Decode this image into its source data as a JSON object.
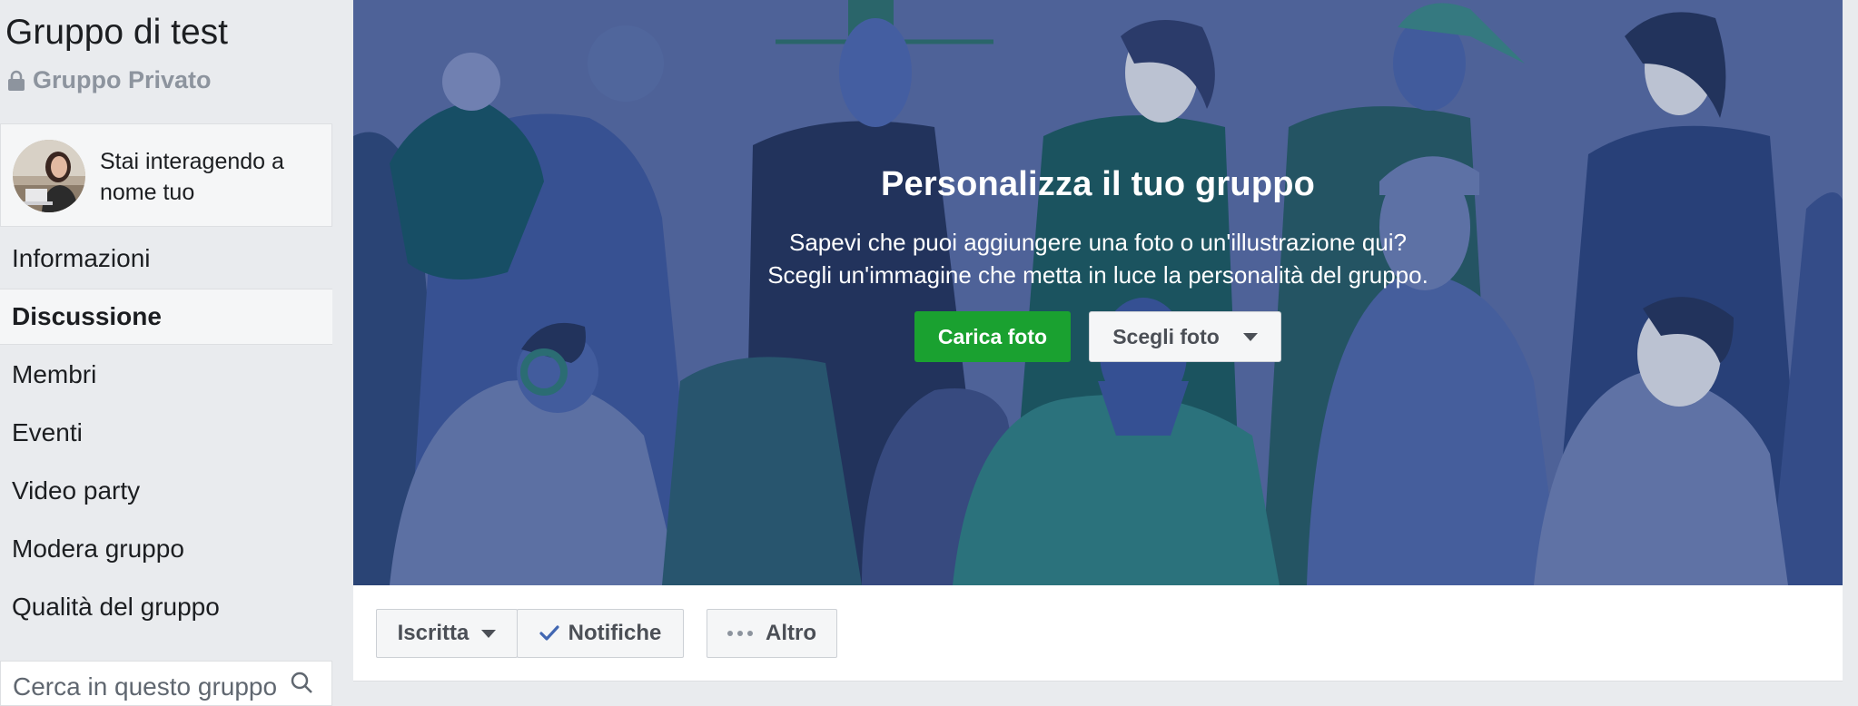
{
  "group": {
    "name": "Gruppo di test",
    "privacy": "Gruppo Privato"
  },
  "acting_as": {
    "text": "Stai interagendo a nome tuo"
  },
  "nav": {
    "items": [
      {
        "label": "Informazioni",
        "active": false
      },
      {
        "label": "Discussione",
        "active": true
      },
      {
        "label": "Membri",
        "active": false
      },
      {
        "label": "Eventi",
        "active": false
      },
      {
        "label": "Video party",
        "active": false
      },
      {
        "label": "Modera gruppo",
        "active": false
      },
      {
        "label": "Qualità del gruppo",
        "active": false
      }
    ]
  },
  "search": {
    "placeholder": "Cerca in questo gruppo"
  },
  "cover": {
    "title": "Personalizza il tuo gruppo",
    "subtitle_line1": "Sapevi che puoi aggiungere una foto o un'illustrazione qui?",
    "subtitle_line2": "Scegli un'immagine che metta in luce la personalità del gruppo.",
    "upload_label": "Carica foto",
    "choose_label": "Scegli foto"
  },
  "actions": {
    "joined_label": "Iscritta",
    "notifications_label": "Notifiche",
    "more_label": "Altro"
  },
  "colors": {
    "page_bg": "#e9ebee",
    "cover_bg": "#5b6fa8",
    "green_button": "#1aa130",
    "check_blue": "#4267b2"
  }
}
